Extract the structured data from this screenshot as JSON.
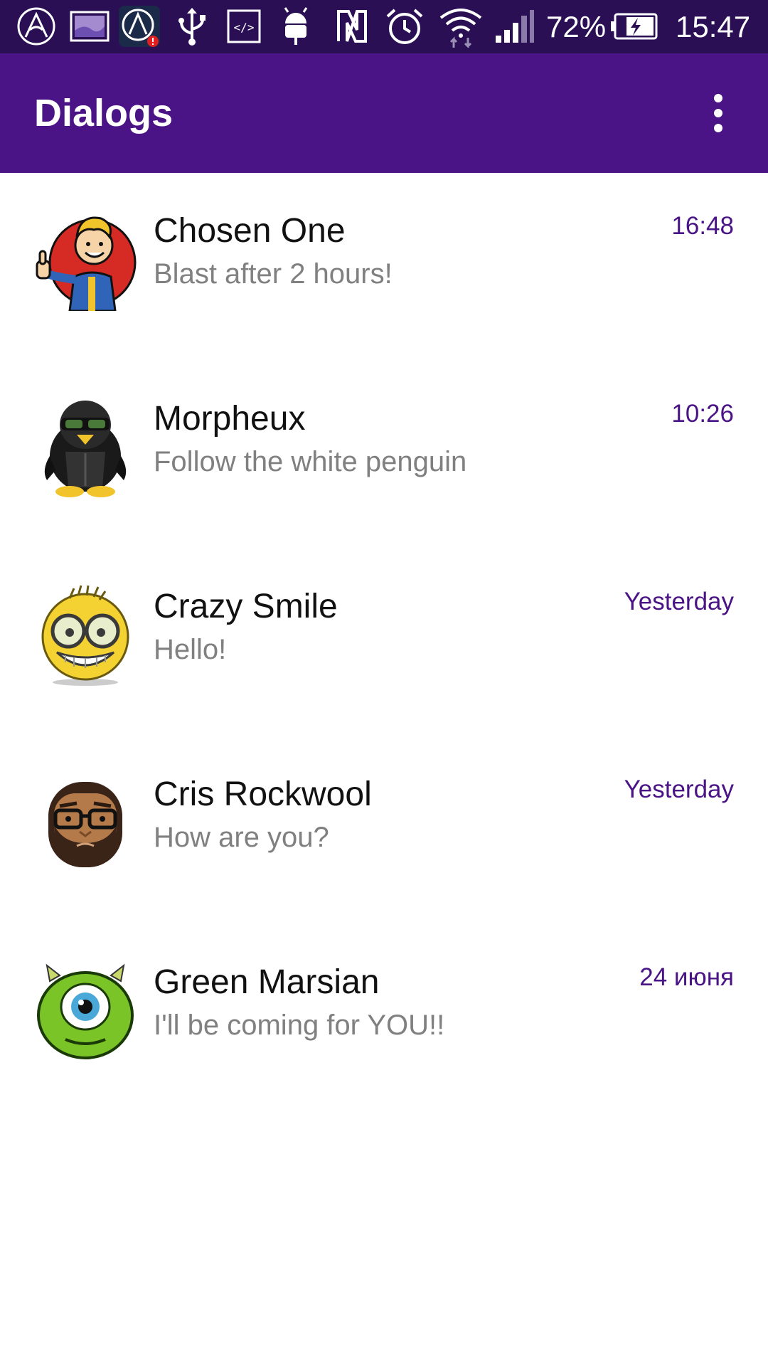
{
  "status_bar": {
    "battery_percent": "72%",
    "time": "15:47",
    "icons": [
      "app-logo-icon",
      "gallery-icon",
      "app-alert-icon",
      "usb-icon",
      "developer-code-icon",
      "android-debug-icon",
      "nfc-icon",
      "alarm-icon",
      "wifi-icon",
      "signal-icon",
      "battery-charging-icon"
    ]
  },
  "app_bar": {
    "title": "Dialogs",
    "menu_icon": "more-vert-icon"
  },
  "dialogs": [
    {
      "name": "Chosen One",
      "message": "Blast after 2 hours!",
      "time": "16:48",
      "avatar": "vault-boy-avatar"
    },
    {
      "name": "Morpheux",
      "message": "Follow the white penguin",
      "time": "10:26",
      "avatar": "penguin-avatar"
    },
    {
      "name": "Crazy Smile",
      "message": "Hello!",
      "time": "Yesterday",
      "avatar": "crazy-smile-avatar"
    },
    {
      "name": "Cris Rockwool",
      "message": "How are you?",
      "time": "Yesterday",
      "avatar": "bearded-man-avatar"
    },
    {
      "name": "Green Marsian",
      "message": "I'll be coming for YOU!!",
      "time": "24 июня",
      "avatar": "green-monster-avatar"
    }
  ],
  "colors": {
    "status_bar": "#2b0f55",
    "app_bar": "#4a1486",
    "accent": "#4a1486",
    "name_text": "#111111",
    "message_text": "#808080"
  }
}
